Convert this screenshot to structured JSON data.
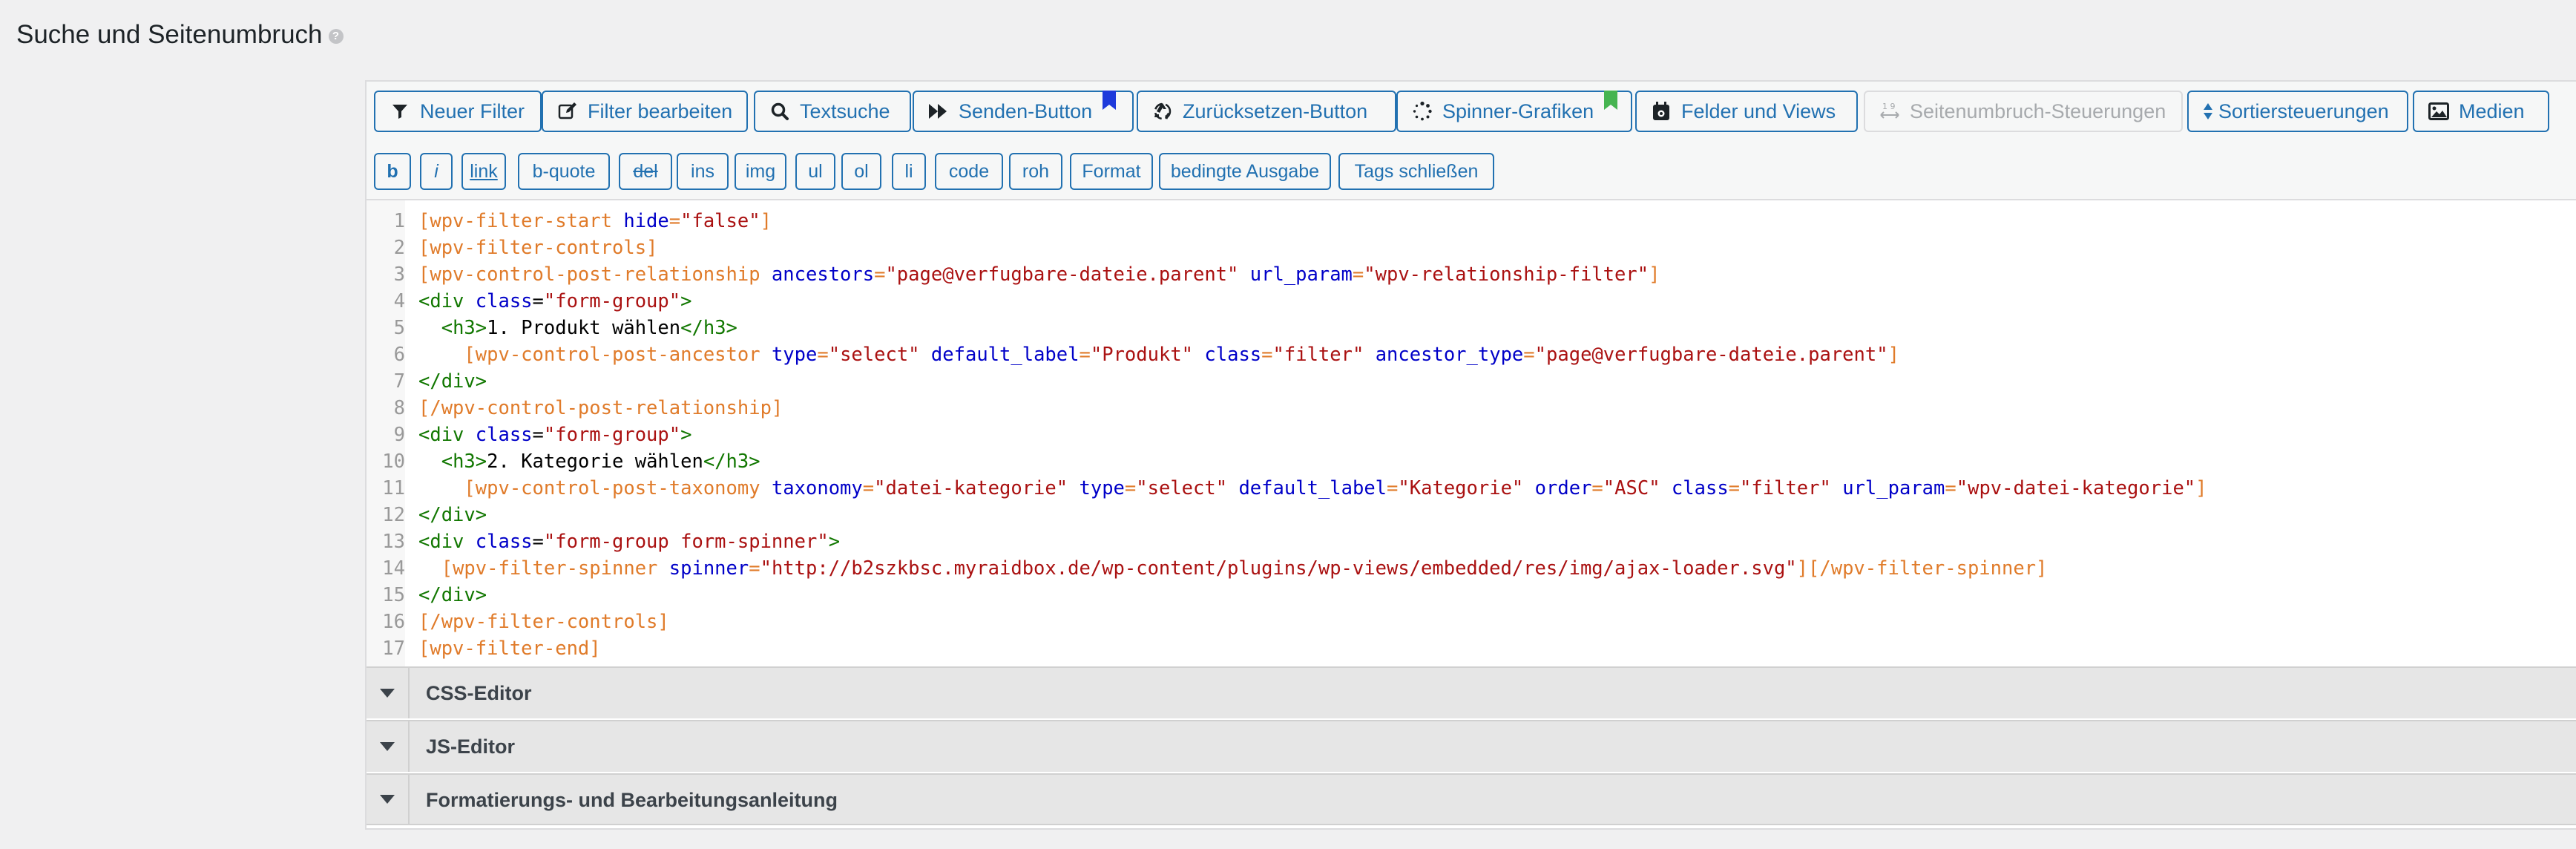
{
  "page": {
    "title": "Suche und Seitenumbruch",
    "help_icon": "?"
  },
  "toolbar": {
    "buttons": [
      {
        "label": "Neuer Filter",
        "icon": "filter-icon"
      },
      {
        "label": "Filter bearbeiten",
        "icon": "edit-icon"
      },
      {
        "label": "Textsuche",
        "icon": "search-icon"
      },
      {
        "label": "Senden-Button",
        "icon": "forward-icon",
        "flag_color": "#1e3adb"
      },
      {
        "label": "Zurücksetzen-Button",
        "icon": "recycle-icon"
      },
      {
        "label": "Spinner-Grafiken",
        "icon": "spinner-icon",
        "flag_color": "#46b450"
      },
      {
        "label": "Felder und Views",
        "icon": "calendar-icon"
      },
      {
        "label": "Seitenumbruch-Steuerungen",
        "icon": "pagination-icon",
        "disabled": true
      },
      {
        "label": "Sortiersteuerungen",
        "icon": "sort-icon"
      },
      {
        "label": "Medien",
        "icon": "image-icon"
      }
    ],
    "quicktags": [
      "b",
      "i",
      "link",
      "b-quote",
      "del",
      "ins",
      "img",
      "ul",
      "ol",
      "li",
      "code",
      "roh",
      "Format",
      "bedingte Ausgabe",
      "Tags schließen"
    ]
  },
  "editor": {
    "line_numbers": [
      "1",
      "2",
      "3",
      "4",
      "5",
      "6",
      "7",
      "8",
      "9",
      "10",
      "11",
      "12",
      "13",
      "14",
      "15",
      "16",
      "17"
    ],
    "lines": [
      [
        [
          "sc",
          "[wpv-filter-start "
        ],
        [
          "attr",
          "hide"
        ],
        [
          "sc",
          "="
        ],
        [
          "str",
          "\"false\""
        ],
        [
          "sc",
          "]"
        ]
      ],
      [
        [
          "sc",
          "[wpv-filter-controls]"
        ]
      ],
      [
        [
          "sc",
          "[wpv-control-post-relationship "
        ],
        [
          "attr",
          "ancestors"
        ],
        [
          "sc",
          "="
        ],
        [
          "str",
          "\"page@verfugbare-dateie.parent\""
        ],
        [
          "sc",
          " "
        ],
        [
          "attr",
          "url_param"
        ],
        [
          "sc",
          "="
        ],
        [
          "str",
          "\"wpv-relationship-filter\""
        ],
        [
          "sc",
          "]"
        ]
      ],
      [
        [
          "tag",
          "<div "
        ],
        [
          "attr",
          "class"
        ],
        [
          "txt",
          "="
        ],
        [
          "str",
          "\"form-group\""
        ],
        [
          "tag",
          ">"
        ]
      ],
      [
        [
          "txt",
          "  "
        ],
        [
          "tag",
          "<h3>"
        ],
        [
          "txt",
          "1. Produkt wählen"
        ],
        [
          "tag",
          "</h3>"
        ]
      ],
      [
        [
          "txt",
          "    "
        ],
        [
          "sc",
          "[wpv-control-post-ancestor "
        ],
        [
          "attr",
          "type"
        ],
        [
          "sc",
          "="
        ],
        [
          "str",
          "\"select\""
        ],
        [
          "sc",
          " "
        ],
        [
          "attr",
          "default_label"
        ],
        [
          "sc",
          "="
        ],
        [
          "str",
          "\"Produkt\""
        ],
        [
          "sc",
          " "
        ],
        [
          "attr",
          "class"
        ],
        [
          "sc",
          "="
        ],
        [
          "str",
          "\"filter\""
        ],
        [
          "sc",
          " "
        ],
        [
          "attr",
          "ancestor_type"
        ],
        [
          "sc",
          "="
        ],
        [
          "str",
          "\"page@verfugbare-dateie.parent\""
        ],
        [
          "sc",
          "]"
        ]
      ],
      [
        [
          "tag",
          "</div>"
        ]
      ],
      [
        [
          "sc",
          "[/wpv-control-post-relationship]"
        ]
      ],
      [
        [
          "tag",
          "<div "
        ],
        [
          "attr",
          "class"
        ],
        [
          "txt",
          "="
        ],
        [
          "str",
          "\"form-group\""
        ],
        [
          "tag",
          ">"
        ]
      ],
      [
        [
          "txt",
          "  "
        ],
        [
          "tag",
          "<h3>"
        ],
        [
          "txt",
          "2. Kategorie wählen"
        ],
        [
          "tag",
          "</h3>"
        ]
      ],
      [
        [
          "txt",
          "    "
        ],
        [
          "sc",
          "[wpv-control-post-taxonomy "
        ],
        [
          "attr",
          "taxonomy"
        ],
        [
          "sc",
          "="
        ],
        [
          "str",
          "\"datei-kategorie\""
        ],
        [
          "sc",
          " "
        ],
        [
          "attr",
          "type"
        ],
        [
          "sc",
          "="
        ],
        [
          "str",
          "\"select\""
        ],
        [
          "sc",
          " "
        ],
        [
          "attr",
          "default_label"
        ],
        [
          "sc",
          "="
        ],
        [
          "str",
          "\"Kategorie\""
        ],
        [
          "sc",
          " "
        ],
        [
          "attr",
          "order"
        ],
        [
          "sc",
          "="
        ],
        [
          "str",
          "\"ASC\""
        ],
        [
          "sc",
          " "
        ],
        [
          "attr",
          "class"
        ],
        [
          "sc",
          "="
        ],
        [
          "str",
          "\"filter\""
        ],
        [
          "sc",
          " "
        ],
        [
          "attr",
          "url_param"
        ],
        [
          "sc",
          "="
        ],
        [
          "str",
          "\"wpv-datei-kategorie\""
        ],
        [
          "sc",
          "]"
        ]
      ],
      [
        [
          "tag",
          "</div>"
        ]
      ],
      [
        [
          "tag",
          "<div "
        ],
        [
          "attr",
          "class"
        ],
        [
          "txt",
          "="
        ],
        [
          "str",
          "\"form-group form-spinner\""
        ],
        [
          "tag",
          ">"
        ]
      ],
      [
        [
          "txt",
          "  "
        ],
        [
          "sc",
          "[wpv-filter-spinner "
        ],
        [
          "attr",
          "spinner"
        ],
        [
          "sc",
          "="
        ],
        [
          "str",
          "\"http://b2szkbsc.myraidbox.de/wp-content/plugins/wp-views/embedded/res/img/ajax-loader.svg\""
        ],
        [
          "sc",
          "][/wpv-filter-spinner]"
        ]
      ],
      [
        [
          "tag",
          "</div>"
        ]
      ],
      [
        [
          "sc",
          "[/wpv-filter-controls]"
        ]
      ],
      [
        [
          "sc",
          "[wpv-filter-end]"
        ]
      ]
    ]
  },
  "sections": [
    {
      "label": "CSS-Editor"
    },
    {
      "label": "JS-Editor"
    },
    {
      "label": "Formatierungs- und Bearbeitungsanleitung"
    }
  ]
}
